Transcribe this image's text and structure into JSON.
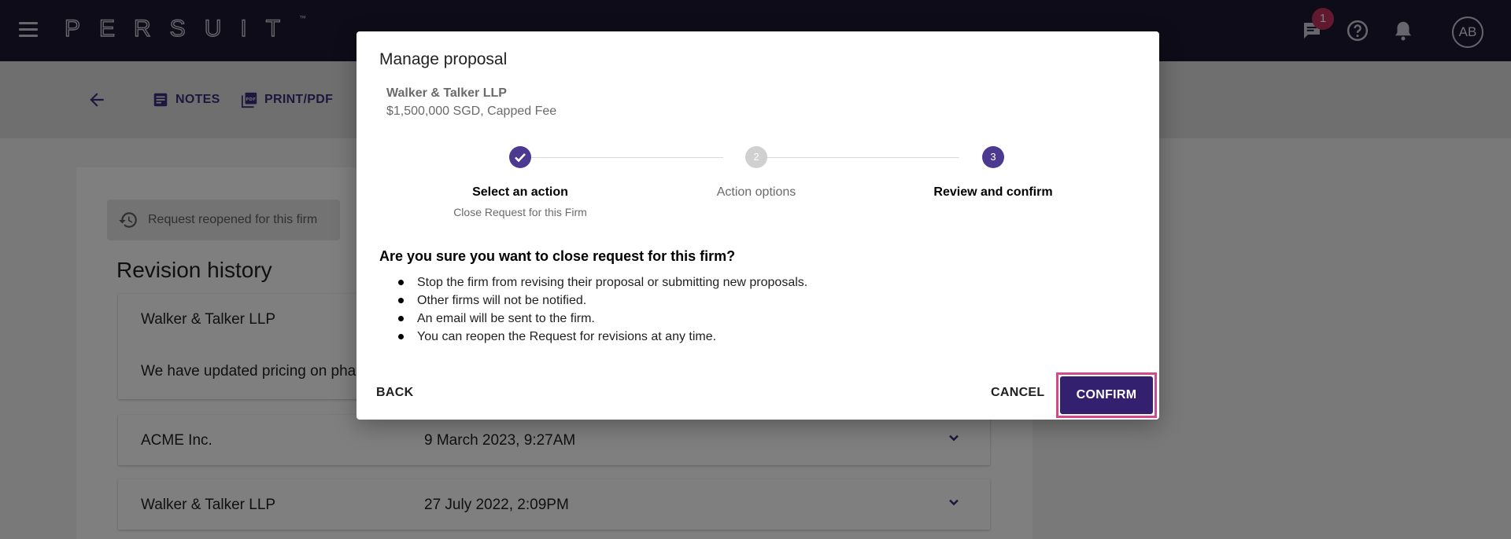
{
  "topbar": {
    "logo": "PERSUIT",
    "logo_tm": "™",
    "message_badge_count": "1",
    "avatar_initials": "AB"
  },
  "toolbar": {
    "notes_label": "NOTES",
    "print_label": "PRINT/PDF"
  },
  "background": {
    "reopened_label": "Request reopened for this firm",
    "revision_title": "Revision history",
    "cards": [
      {
        "firm": "Walker & Talker LLP",
        "message": "We have updated pricing on pha",
        "date": ""
      },
      {
        "firm": "ACME Inc.",
        "date": "9 March 2023, 9:27AM"
      },
      {
        "firm": "Walker & Talker LLP",
        "date": "27 July 2022, 2:09PM"
      }
    ]
  },
  "modal": {
    "title": "Manage proposal",
    "firm_name": "Walker & Talker LLP",
    "firm_price": "$1,500,000 SGD, Capped Fee",
    "steps": [
      {
        "number": "1",
        "label": "Select an action",
        "sublabel": "Close Request for this Firm",
        "state": "completed"
      },
      {
        "number": "2",
        "label": "Action options",
        "sublabel": "",
        "state": "inactive"
      },
      {
        "number": "3",
        "label": "Review and confirm",
        "sublabel": "",
        "state": "active"
      }
    ],
    "question": "Are you sure you want to close request for this firm?",
    "bullets": [
      "Stop the firm from revising their proposal or submitting new proposals.",
      "Other firms will not be notified.",
      "An email will be sent to the firm.",
      "You can reopen the Request for revisions at any time."
    ],
    "back_label": "BACK",
    "cancel_label": "CANCEL",
    "confirm_label": "CONFIRM"
  },
  "colors": {
    "topbar_bg": "#1d1933",
    "brand_purple": "#33216f",
    "step_active": "#4b3a8f",
    "step_inactive": "#d0d0d0",
    "badge": "#c3325f",
    "highlight_outline": "#d24a8e"
  }
}
